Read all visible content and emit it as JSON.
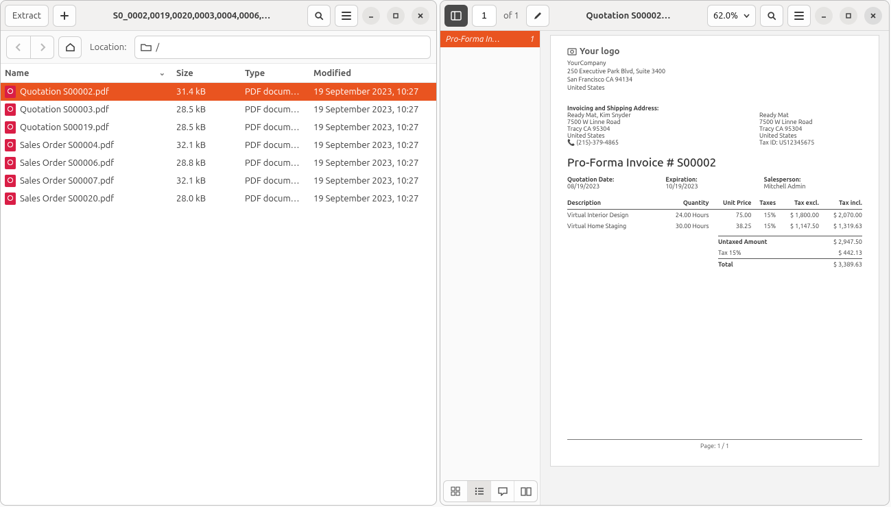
{
  "left": {
    "extract_label": "Extract",
    "title": "S0_0002,0019,0020,0003,0004,0006,…",
    "location_label": "Location:",
    "path": "/",
    "columns": {
      "name": "Name",
      "size": "Size",
      "type": "Type",
      "modified": "Modified"
    },
    "files": [
      {
        "name": "Quotation S00002.pdf",
        "size": "31.4 kB",
        "type": "PDF docum…",
        "modified": "19 September 2023, 10:27",
        "selected": true
      },
      {
        "name": "Quotation S00003.pdf",
        "size": "28.5 kB",
        "type": "PDF docum…",
        "modified": "19 September 2023, 10:27"
      },
      {
        "name": "Quotation S00019.pdf",
        "size": "28.5 kB",
        "type": "PDF docum…",
        "modified": "19 September 2023, 10:27"
      },
      {
        "name": "Sales Order S00004.pdf",
        "size": "32.1 kB",
        "type": "PDF docum…",
        "modified": "19 September 2023, 10:27"
      },
      {
        "name": "Sales Order S00006.pdf",
        "size": "28.8 kB",
        "type": "PDF docum…",
        "modified": "19 September 2023, 10:27"
      },
      {
        "name": "Sales Order S00007.pdf",
        "size": "32.1 kB",
        "type": "PDF docum…",
        "modified": "19 September 2023, 10:27"
      },
      {
        "name": "Sales Order S00020.pdf",
        "size": "28.0 kB",
        "type": "PDF docum…",
        "modified": "19 September 2023, 10:27"
      }
    ]
  },
  "right": {
    "page_current": "1",
    "page_of_label": "of 1",
    "title": "Quotation S00002…",
    "zoom": "62.0%",
    "thumb_label": "Pro-Forma In…",
    "thumb_page": "1",
    "page_footer": "Page: 1 / 1"
  },
  "doc": {
    "logo_text": "Your logo",
    "company": {
      "name": "YourCompany",
      "street": "250 Executive Park Blvd, Suite 3400",
      "citystate": "San Francisco CA 94134",
      "country": "United States"
    },
    "ship_header": "Invoicing and Shipping Address:",
    "bill": {
      "name": "Ready Mat, Kim Snyder",
      "street": "7500 W Linne Road",
      "citystate": "Tracy CA 95304",
      "country": "United States",
      "phone": "(215)-379-4865"
    },
    "ship": {
      "name": "Ready Mat",
      "street": "7500 W Linne Road",
      "citystate": "Tracy CA 95304",
      "country": "United States",
      "taxid": "Tax ID: US12345675"
    },
    "title": "Pro-Forma Invoice # S00002",
    "meta": {
      "qdate_h": "Quotation Date:",
      "qdate": "08/19/2023",
      "exp_h": "Expiration:",
      "exp": "10/19/2023",
      "sales_h": "Salesperson:",
      "sales": "Mitchell Admin"
    },
    "cols": {
      "desc": "Description",
      "qty": "Quantity",
      "unit": "Unit Price",
      "tax": "Taxes",
      "excl": "Tax excl.",
      "incl": "Tax incl."
    },
    "lines": [
      {
        "desc": "Virtual Interior Design",
        "qty": "24.00 Hours",
        "unit": "75.00",
        "tax": "15%",
        "excl": "$ 1,800.00",
        "incl": "$ 2,070.00"
      },
      {
        "desc": "Virtual Home Staging",
        "qty": "30.00 Hours",
        "unit": "38.25",
        "tax": "15%",
        "excl": "$ 1,147.50",
        "incl": "$ 1,319.63"
      }
    ],
    "totals": {
      "untaxed_h": "Untaxed Amount",
      "untaxed": "$ 2,947.50",
      "tax_h": "Tax 15%",
      "tax": "$ 442.13",
      "total_h": "Total",
      "total": "$ 3,389.63"
    }
  }
}
